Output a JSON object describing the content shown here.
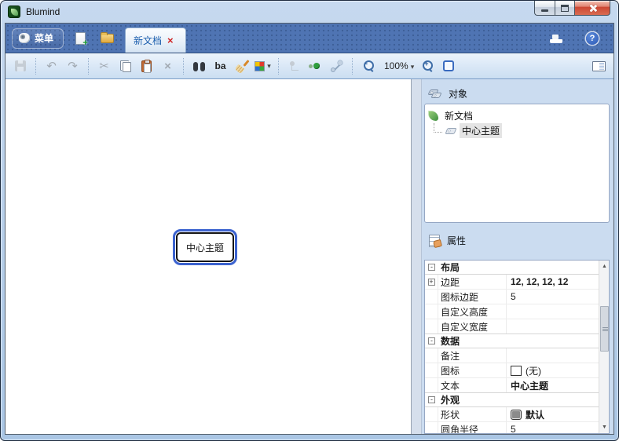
{
  "titlebar": {
    "title": "Blumind"
  },
  "menubar": {
    "menu_button": "菜单",
    "tab_label": "新文档"
  },
  "toolbar": {
    "zoom_value": "100%"
  },
  "canvas": {
    "central_topic": "中心主题"
  },
  "objects_panel": {
    "title": "对象",
    "tree": [
      {
        "label": "新文档",
        "level": 0
      },
      {
        "label": "中心主题",
        "level": 1,
        "selected": true
      }
    ]
  },
  "properties_panel": {
    "title": "属性",
    "rows": [
      {
        "type": "category",
        "expander": "-",
        "name": "布局",
        "value": ""
      },
      {
        "type": "property",
        "expander": "+",
        "name": "边距",
        "value": "12, 12, 12, 12",
        "bold": true
      },
      {
        "type": "property",
        "name": "图标边距",
        "value": "5"
      },
      {
        "type": "property",
        "name": "自定义高度",
        "value": ""
      },
      {
        "type": "property",
        "name": "自定义宽度",
        "value": ""
      },
      {
        "type": "category",
        "expander": "-",
        "name": "数据",
        "value": ""
      },
      {
        "type": "property",
        "name": "备注",
        "value": ""
      },
      {
        "type": "property",
        "name": "图标",
        "value": "(无)",
        "swatch": "none"
      },
      {
        "type": "property",
        "name": "文本",
        "value": "中心主题",
        "bold": true
      },
      {
        "type": "category",
        "expander": "-",
        "name": "外观",
        "value": ""
      },
      {
        "type": "property",
        "name": "形状",
        "value": "默认",
        "bold": true,
        "swatch": "shape"
      },
      {
        "type": "property",
        "name": "圆角半径",
        "value": "5"
      }
    ]
  },
  "icons": {
    "undo": "↶",
    "redo": "↷",
    "cut": "✂",
    "delete_x": "×",
    "tab_close": "×",
    "help": "?",
    "font_glyph": "ba",
    "scroll_up": "▲",
    "scroll_down": "▼",
    "zoom_minus": "-",
    "zoom_plus": "+"
  },
  "colors": {
    "menubar_blue": "#4f74b3",
    "selection_blue": "#3c63cf",
    "tab_text": "#1c5fae",
    "close_red": "#cc4733",
    "panel_bg": "#cbdcf0"
  }
}
